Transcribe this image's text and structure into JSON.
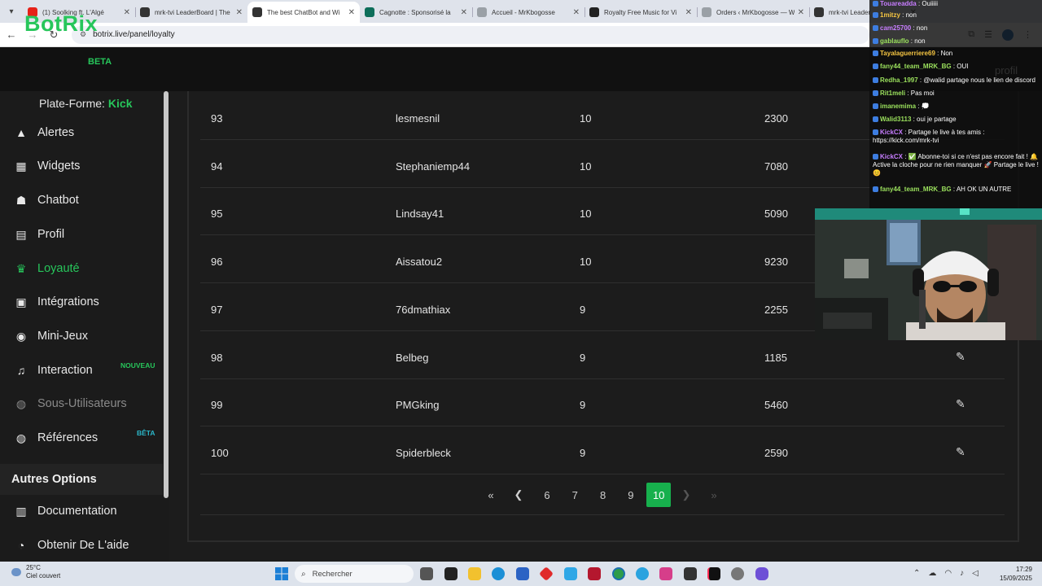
{
  "browser": {
    "tabs": [
      {
        "label": "(1) Soolking ft. L'Algé",
        "favicon_color": "#e62117",
        "active": false
      },
      {
        "label": "mrk-tvi LeaderBoard | The",
        "favicon_color": "#333333",
        "active": false
      },
      {
        "label": "The best ChatBot and Wi",
        "favicon_color": "#333333",
        "active": true
      },
      {
        "label": "Cagnotte : Sponsorisé la",
        "favicon_color": "#0d6e5a",
        "active": false
      },
      {
        "label": "Accueil - MrKbogosse",
        "favicon_color": "#9aa0a6",
        "active": false
      },
      {
        "label": "Royalty Free Music for Vi",
        "favicon_color": "#222222",
        "active": false
      },
      {
        "label": "Orders ‹ MrKbogosse — W",
        "favicon_color": "#9aa0a6",
        "active": false
      },
      {
        "label": "mrk-tvi Leader",
        "favicon_color": "#333333",
        "active": false
      }
    ],
    "url": "botrix.live/panel/loyalty"
  },
  "app": {
    "logo": "BotRix",
    "beta": "BETA",
    "profile_link": "profil"
  },
  "sidebar": {
    "platform_label": "Plate-Forme:",
    "platform_value": "Kick",
    "items": [
      {
        "label": "Alertes",
        "icon": "warning-icon",
        "glyph": "▲",
        "state": "normal"
      },
      {
        "label": "Widgets",
        "icon": "grid-icon",
        "glyph": "▦",
        "state": "normal"
      },
      {
        "label": "Chatbot",
        "icon": "robot-icon",
        "glyph": "☗",
        "state": "normal"
      },
      {
        "label": "Profil",
        "icon": "id-card-icon",
        "glyph": "▤",
        "state": "normal"
      },
      {
        "label": "Loyauté",
        "icon": "trophy-icon",
        "glyph": "♛",
        "state": "active"
      },
      {
        "label": "Intégrations",
        "icon": "integration-icon",
        "glyph": "▣",
        "state": "normal"
      },
      {
        "label": "Mini-Jeux",
        "icon": "gamepad-icon",
        "glyph": "◉",
        "state": "normal"
      },
      {
        "label": "Interaction",
        "icon": "music-icon",
        "glyph": "♫",
        "state": "normal",
        "badge": "NOUVEAU"
      },
      {
        "label": "Sous-Utilisateurs",
        "icon": "users-icon",
        "glyph": "◍",
        "state": "disabled"
      },
      {
        "label": "Références",
        "icon": "people-icon",
        "glyph": "◍",
        "state": "normal",
        "badge": "BÊTA"
      }
    ],
    "section_title": "Autres Options",
    "other_items": [
      {
        "label": "Documentation",
        "icon": "book-icon",
        "glyph": "▥"
      },
      {
        "label": "Obtenir De L'aide",
        "icon": "help-icon",
        "glyph": "◔"
      }
    ]
  },
  "leaderboard": {
    "rows": [
      {
        "rank": "93",
        "user": "lesmesnil",
        "level": "10",
        "points": "2300"
      },
      {
        "rank": "94",
        "user": "Stephaniemp44",
        "level": "10",
        "points": "7080"
      },
      {
        "rank": "95",
        "user": "Lindsay41",
        "level": "10",
        "points": "5090"
      },
      {
        "rank": "96",
        "user": "Aissatou2",
        "level": "10",
        "points": "9230"
      },
      {
        "rank": "97",
        "user": "76dmathiax",
        "level": "9",
        "points": "2255"
      },
      {
        "rank": "98",
        "user": "Belbeg",
        "level": "9",
        "points": "1185"
      },
      {
        "rank": "99",
        "user": "PMGking",
        "level": "9",
        "points": "5460"
      },
      {
        "rank": "100",
        "user": "Spiderbleck",
        "level": "9",
        "points": "2590"
      }
    ],
    "edit_icon": "✎",
    "pagination": {
      "first": "«",
      "prev": "❮",
      "pages": [
        "6",
        "7",
        "8",
        "9",
        "10"
      ],
      "current": "10",
      "next": "❯",
      "last": "»"
    }
  },
  "chat": {
    "messages": [
      {
        "user": "Touareadda",
        "text": " : Ouiiiii",
        "color": "#c77dff"
      },
      {
        "user": "1mitzy",
        "text": " : non",
        "color": "#f5c542"
      },
      {
        "user": "cam25700",
        "text": " : non",
        "color": "#c77dff"
      },
      {
        "user": "gablauflo",
        "text": " : non",
        "color": "#9be15d"
      },
      {
        "user": "Tayalaguerriere69",
        "text": " : Non",
        "color": "#f5c542"
      },
      {
        "user": "fany44_team_MRK_BG",
        "text": " : OUI",
        "color": "#9be15d"
      },
      {
        "user": "Redha_1997",
        "text": " : @walid partage nous le lien de discord",
        "color": "#9be15d"
      },
      {
        "user": "Rit1meli",
        "text": " : Pas moi",
        "color": "#9be15d"
      },
      {
        "user": "imanemima",
        "text": " : 💭",
        "color": "#9be15d"
      },
      {
        "user": "Walid3113",
        "text": " : oui je partage",
        "color": "#9be15d"
      },
      {
        "user": "KickCX",
        "text": " : Partage le live à tes amis : https://kick.com/mrk-tvi",
        "color": "#c77dff"
      },
      {
        "user": "KickCX",
        "text": " : ✅ Abonne-toi si ce n'est pas encore fait ! 🔔 Active la cloche pour ne rien manquer 🚀 Partage le live ! 😊",
        "color": "#c77dff"
      },
      {
        "user": "fany44_team_MRK_BG",
        "text": " : AH OK UN AUTRE",
        "color": "#9be15d"
      }
    ]
  },
  "taskbar": {
    "temperature": "25°C",
    "weather": "Ciel couvert",
    "search_placeholder": "Rechercher",
    "time": "17:29",
    "date": "15/09/2025"
  }
}
